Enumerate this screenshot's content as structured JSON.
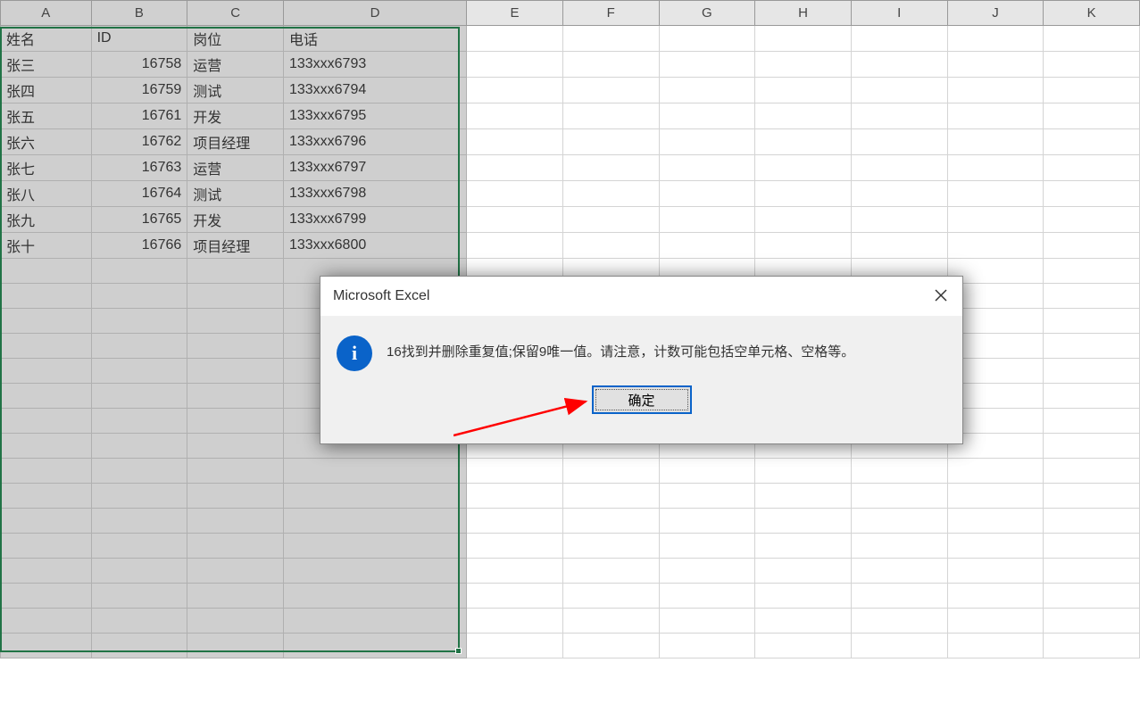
{
  "columns": [
    "A",
    "B",
    "C",
    "D",
    "E",
    "F",
    "G",
    "H",
    "I",
    "J",
    "K"
  ],
  "selected_columns": [
    "A",
    "B",
    "C",
    "D"
  ],
  "widths": {
    "A": 100,
    "B": 106,
    "C": 106,
    "D": 202,
    "E": 106,
    "F": 106,
    "G": 106,
    "H": 106,
    "I": 106,
    "J": 106,
    "K": 106
  },
  "headers": {
    "A": "姓名",
    "B": "ID",
    "C": "岗位",
    "D": "电话"
  },
  "rows": [
    {
      "A": "张三",
      "B": "16758",
      "C": "运营",
      "D": "133xxx6793"
    },
    {
      "A": "张四",
      "B": "16759",
      "C": "测试",
      "D": "133xxx6794"
    },
    {
      "A": "张五",
      "B": "16761",
      "C": "开发",
      "D": "133xxx6795"
    },
    {
      "A": "张六",
      "B": "16762",
      "C": "项目经理",
      "D": "133xxx6796"
    },
    {
      "A": "张七",
      "B": "16763",
      "C": "运营",
      "D": "133xxx6797"
    },
    {
      "A": "张八",
      "B": "16764",
      "C": "测试",
      "D": "133xxx6798"
    },
    {
      "A": "张九",
      "B": "16765",
      "C": "开发",
      "D": "133xxx6799"
    },
    {
      "A": "张十",
      "B": "16766",
      "C": "项目经理",
      "D": "133xxx6800"
    }
  ],
  "empty_row_count": 16,
  "dialog": {
    "title": "Microsoft Excel",
    "message": "16找到并删除重复值;保留9唯一值。请注意，计数可能包括空单元格、空格等。",
    "ok_label": "确定",
    "icon_glyph": "i"
  }
}
